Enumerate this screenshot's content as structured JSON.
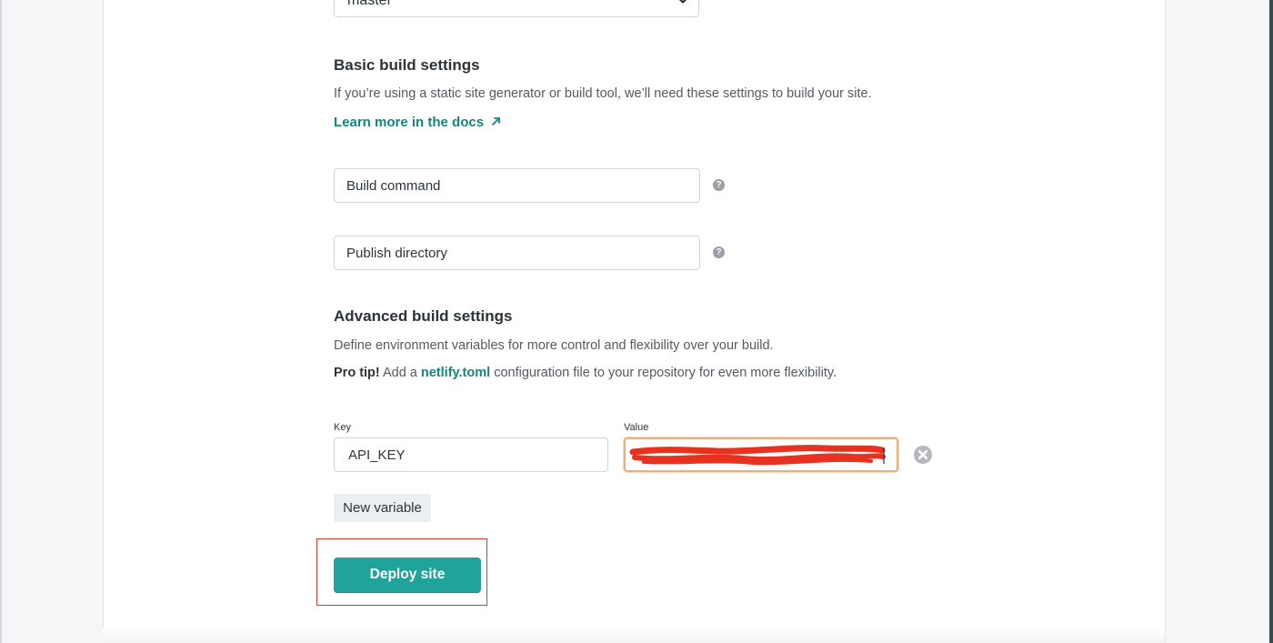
{
  "repository": {
    "branch_value": "master"
  },
  "basic": {
    "heading": "Basic build settings",
    "description": "If you’re using a static site generator or build tool, we’ll need these settings to build your site.",
    "docs_link": "Learn more in the docs",
    "docs_link_icon": "external-arrow-icon",
    "build_command_placeholder": "Build command",
    "publish_directory_placeholder": "Publish directory",
    "help_glyph": "?"
  },
  "advanced": {
    "heading": "Advanced build settings",
    "description": "Define environment variables for more control and flexibility over your build.",
    "pro_tip_label": "Pro tip!",
    "pro_tip_before": " Add a ",
    "pro_tip_link": "netlify.toml",
    "pro_tip_after": " configuration file to your repository for even more flexibility.",
    "key_label": "Key",
    "value_label": "Value",
    "variable_key": "API_KEY",
    "value_redacted": true,
    "remove_icon": "close-circle-icon",
    "new_variable_label": "New variable"
  },
  "actions": {
    "deploy_label": "Deploy site"
  },
  "colors": {
    "accent_teal": "#20a39a",
    "link_teal": "#15847d",
    "annotation_red": "#e0392b",
    "focus_orange": "#e9b07e"
  }
}
